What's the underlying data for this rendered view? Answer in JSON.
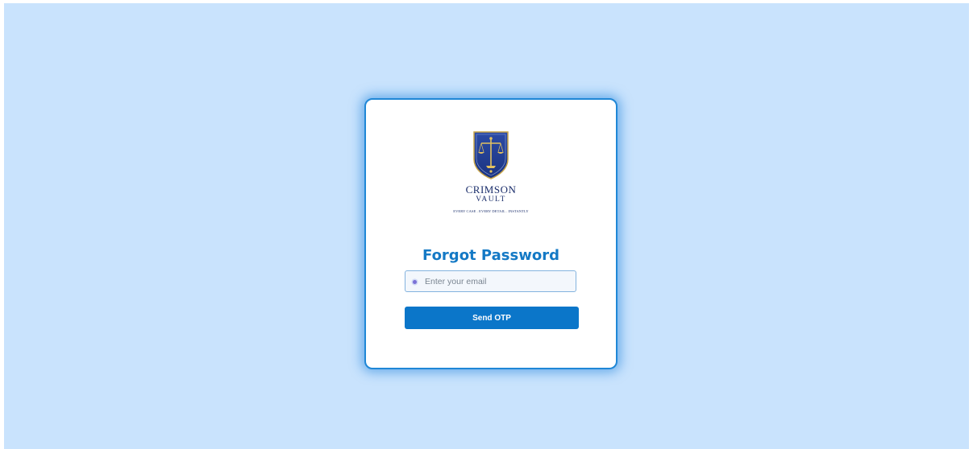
{
  "brand": {
    "name": "CRIMSON",
    "sub": "VAULT",
    "tagline": "EVERY CASE . EVERY DETAIL . INSTANTLY",
    "logo_icon": "scales-of-justice-shield-icon"
  },
  "form": {
    "title": "Forgot Password",
    "email_placeholder": "Enter your email",
    "email_value": "",
    "email_icon": "email-dot-icon",
    "submit_label": "Send OTP"
  },
  "colors": {
    "background": "#c9e3fd",
    "accent": "#0b76c9",
    "title": "#1479c5",
    "brand_navy": "#1b2e6b"
  }
}
